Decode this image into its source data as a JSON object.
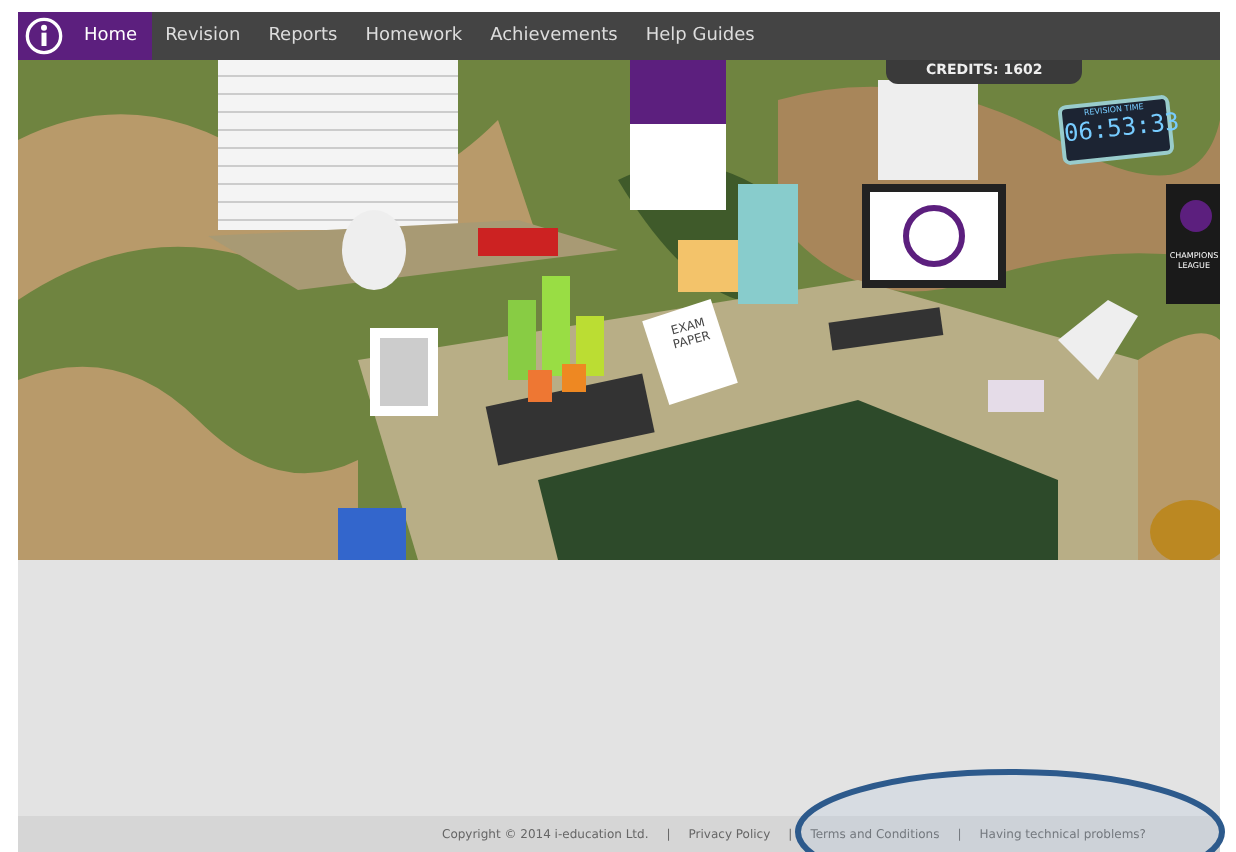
{
  "nav": {
    "items": [
      {
        "label": "Home",
        "selected": true
      },
      {
        "label": "Revision",
        "selected": false
      },
      {
        "label": "Reports",
        "selected": false
      },
      {
        "label": "Homework",
        "selected": false
      },
      {
        "label": "Achievements",
        "selected": false
      },
      {
        "label": "Help Guides",
        "selected": false
      }
    ]
  },
  "credits": "CREDITS: 1602",
  "scene": {
    "clock_label": "REVISION TIME",
    "clock_time": "06:53:33",
    "exam_paper": "EXAM PAPER",
    "poster": "CHAMPIONS LEAGUE"
  },
  "footer": {
    "separator": "|",
    "copyright": "Copyright © 2014 i-education Ltd.",
    "links": [
      "Privacy Policy",
      "Terms and Conditions",
      "Having technical problems?"
    ]
  }
}
